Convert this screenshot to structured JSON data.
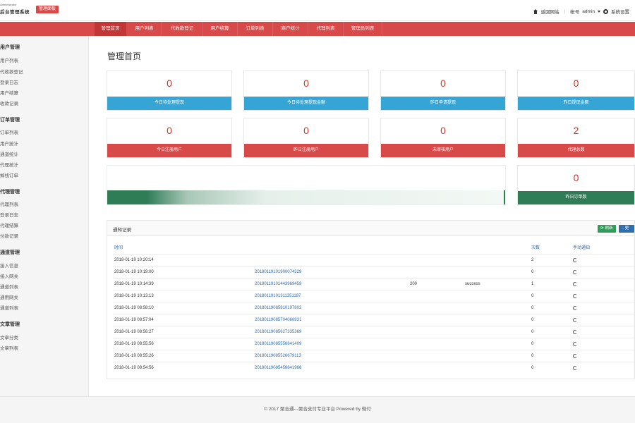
{
  "header": {
    "brand_sub": "Administrator",
    "brand_title": "后台管理系统",
    "badge": "管理面板",
    "back_site": "返回网站",
    "account_label": "帐号",
    "account_name": "admin",
    "settings": "系统设置"
  },
  "nav": {
    "items": [
      "管理首页",
      "用户列表",
      "代收款登记",
      "用户结算",
      "订单列表",
      "商户统计",
      "代理列表",
      "管理员列表"
    ],
    "active_index": 0
  },
  "sidebar": {
    "groups": [
      {
        "title": "用户管理",
        "items": [
          "用户列表",
          "代收款登记",
          "登录日志",
          "用户结算",
          "收款记录"
        ]
      },
      {
        "title": "订单管理",
        "items": [
          "订单列表",
          "用户统计",
          "通道统计",
          "代理统计",
          "掉线订单"
        ]
      },
      {
        "title": "代理管理",
        "items": [
          "代理列表",
          "登录日志",
          "代理结算",
          "付款记录"
        ]
      },
      {
        "title": "通道管理",
        "items": [
          "接入信息",
          "接入网关",
          "通道列表",
          "通用网关",
          "通道列表"
        ]
      },
      {
        "title": "文章管理",
        "items": [
          "文章分类",
          "文章列表"
        ]
      }
    ]
  },
  "main": {
    "page_title": "管理首页",
    "stats": [
      {
        "value": "0",
        "label": "今日待处理提现",
        "color": "blue"
      },
      {
        "value": "0",
        "label": "今日待处理提现金额",
        "color": "blue"
      },
      {
        "value": "0",
        "label": "昨日申请提现",
        "color": "blue"
      },
      {
        "value": "0",
        "label": "昨日提现金额",
        "color": "blue"
      },
      {
        "value": "0",
        "label": "今日注册用户",
        "color": "red"
      },
      {
        "value": "0",
        "label": "昨日注册用户",
        "color": "red"
      },
      {
        "value": "0",
        "label": "未审核用户",
        "color": "red"
      },
      {
        "value": "2",
        "label": "代理总数",
        "color": "red"
      },
      {
        "value": "0",
        "label": "昨日订单数",
        "color": "green"
      }
    ],
    "progress_fraction": 0.99
  },
  "notify": {
    "title": "通知记录",
    "refresh_label": "刷新",
    "more_label": "更多",
    "columns": {
      "time": "时间",
      "count": "次数",
      "retry": "手动通知"
    },
    "rows": [
      {
        "time": "2018-01-19 10:20:14",
        "order": "",
        "code": "",
        "status": "",
        "count": "2"
      },
      {
        "time": "2018-01-19 10:19:00",
        "order": "20180119101900074329",
        "code": "",
        "status": "",
        "count": "0"
      },
      {
        "time": "2018-01-19 10:14:39",
        "order": "20180119101443969459",
        "code": "200",
        "status": "success",
        "count": "1"
      },
      {
        "time": "2018-01-19 10:13:13",
        "order": "20180119101311351187",
        "code": "",
        "status": "",
        "count": "0"
      },
      {
        "time": "2018-01-19 08:58:10",
        "order": "20180119085810197802",
        "code": "",
        "status": "",
        "count": "0"
      },
      {
        "time": "2018-01-19 08:57:04",
        "order": "20180119085704066931",
        "code": "",
        "status": "",
        "count": "0"
      },
      {
        "time": "2018-01-19 08:56:27",
        "order": "20180119085627335369",
        "code": "",
        "status": "",
        "count": "0"
      },
      {
        "time": "2018-01-19 08:55:56",
        "order": "20180119085556841409",
        "code": "",
        "status": "",
        "count": "0"
      },
      {
        "time": "2018-01-19 08:55:26",
        "order": "20180119085526679113",
        "code": "",
        "status": "",
        "count": "0"
      },
      {
        "time": "2018-01-19 08:54:56",
        "order": "20180119085456841968",
        "code": "",
        "status": "",
        "count": "0"
      }
    ]
  },
  "footer": {
    "text": "© 2017 聚合通---聚合支付专业平台 Powered by 微付"
  }
}
